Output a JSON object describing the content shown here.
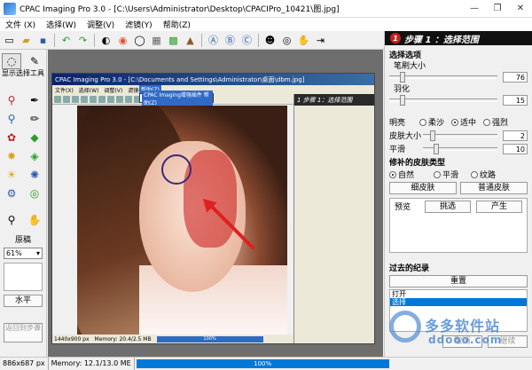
{
  "window": {
    "title": "CPAC Imaging Pro 3.0 - [C:\\Users\\Administrator\\Desktop\\CPACIPro_10421\\图.jpg]",
    "minimize": "—",
    "maximize": "❐",
    "close": "✕"
  },
  "menu": [
    "文件 (X)",
    "选择(W)",
    "调整(V)",
    "滤镜(Y)",
    "帮助(Z)"
  ],
  "toolbar_icons": [
    "new-icon",
    "open-icon",
    "save-icon",
    "undo-icon",
    "redo-icon",
    "contrast-icon",
    "color-wheel-icon",
    "ring-icon",
    "gradient-icon",
    "grid-icon",
    "hat-icon",
    "a-icon",
    "b-icon",
    "c-icon",
    "eye-icon",
    "person-icon",
    "hands-icon",
    "export-icon"
  ],
  "left_panel": {
    "show_tools_label": "显示选择工具",
    "zoom_label": "原稿",
    "zoom_value": "61%",
    "horizontal_button": "水平",
    "back_button": "返回到步骤"
  },
  "inner": {
    "title": "CPAC Imaging Pro 3.0 - [C:\\Documents and Settings\\Administrator\\桌面\\dbm.jpg]",
    "menu": [
      "文件(X)",
      "选择(W)",
      "调整(V)",
      "滤镜(Y)",
      "帮助(Z)"
    ],
    "help_menu": "帮助(Z)",
    "dropdown_item": "CPAC Imaging增强插件 帮助(Z)",
    "head": "1 步骤 1：选择范围",
    "status_size": "1440x900 px",
    "status_mem": "Memory: 20.4/2.5 MB",
    "progress": "100%"
  },
  "right_panel": {
    "step_number": "1",
    "step_title": "步骤 1 ：选择范围",
    "select_options": "选择选项",
    "brush_size_label": "笔刷大小",
    "brush_size": "76",
    "feather_label": "羽化",
    "feather": "15",
    "brightness_label": "明亮",
    "brightness_options": [
      "柔沙",
      "适中",
      "强烈"
    ],
    "brightness_selected": 1,
    "skin_size_label": "皮肤大小",
    "skin_size": "2",
    "smooth_label": "平滑",
    "smooth": "10",
    "skin_type_title": "修补的皮肤类型",
    "skin_type_options": [
      "自然",
      "平滑",
      "纹路"
    ],
    "skin_type_selected": 0,
    "fine_skin_button": "细皮肤",
    "normal_skin_button": "普通皮肤",
    "preview_label": "预览",
    "pick_button": "挑选",
    "generate_button": "产生",
    "history_title": "过去的纪录",
    "reset_button": "重置",
    "history_items": [
      "打开",
      "选择"
    ],
    "cancel_button": "取消",
    "continue_button": "继续"
  },
  "statusbar": {
    "size": "886x687 px",
    "memory": "Memory: 12.1/13.0 ME",
    "progress": "100%",
    "progress_value": 100
  },
  "watermark": {
    "cn": "多多软件站",
    "url": "ddooo.com"
  },
  "colors": {
    "accent": "#0078d7",
    "step_head": "#111111",
    "arrow": "#e02020"
  }
}
